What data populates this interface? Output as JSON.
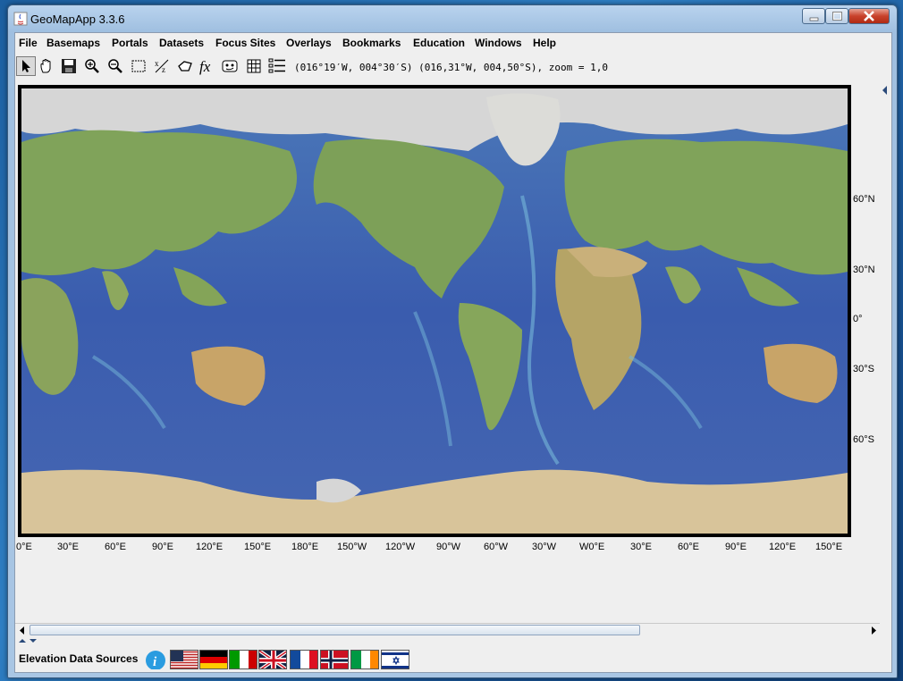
{
  "window": {
    "title": "GeoMapApp 3.3.6"
  },
  "menu": [
    "File",
    "Basemaps",
    "Portals",
    "Datasets",
    "Focus Sites",
    "Overlays",
    "Bookmarks",
    "Education",
    "Windows",
    "Help"
  ],
  "toolbar": {
    "coords": "(016°19′W, 004°30′S) (016,31°W, 004,50°S), zoom = 1,0",
    "tools": [
      "select-arrow-icon",
      "pan-hand-icon",
      "save-disk-icon",
      "zoom-in-icon",
      "zoom-out-icon",
      "select-region-icon",
      "xz-profile-icon",
      "lasso-icon",
      "fx-icon",
      "digitize-icon",
      "grid-icon",
      "list-icon"
    ]
  },
  "map": {
    "lat_labels": [
      "60°N",
      "30°N",
      "0°",
      "30°S",
      "60°S"
    ],
    "lon_labels": [
      "0°E",
      "30°E",
      "60°E",
      "90°E",
      "120°E",
      "150°E",
      "180°E",
      "150°W",
      "120°W",
      "90°W",
      "60°W",
      "30°W",
      "W0°E",
      "30°E",
      "60°E",
      "90°E",
      "120°E",
      "150°E"
    ]
  },
  "bottom": {
    "label": "Elevation Data Sources",
    "flags": [
      "info-icon",
      "usa-flag",
      "germany-flag",
      "italy-flag",
      "uk-flag",
      "france-flag",
      "norway-flag",
      "ireland-flag",
      "israel-flag"
    ]
  },
  "colors": {
    "ocean": "#3e5fae",
    "land": "#7fa05c",
    "ice": "#d8d8d8",
    "titlebar": "#a9c6e4"
  }
}
